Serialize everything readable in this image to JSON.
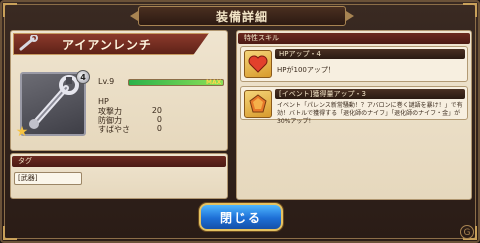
{
  "window": {
    "title": "装備詳細"
  },
  "item": {
    "name": "アイアンレンチ",
    "rarity_badge": "4",
    "level_label": "Lv.9",
    "level_progress": 1.0,
    "level_max_label": "MAX",
    "stats": [
      {
        "label": "HP",
        "value": ""
      },
      {
        "label": "攻撃力",
        "value": "20"
      },
      {
        "label": "防御力",
        "value": "0"
      },
      {
        "label": "すばやさ",
        "value": "0"
      }
    ]
  },
  "tag_section": {
    "header": "タグ",
    "tags": [
      "[武器]"
    ]
  },
  "skill_section": {
    "header": "特性スキル",
    "skills": [
      {
        "name": "HPアップ・4",
        "description": "HPが100アップ！",
        "icon": "heart-icon"
      },
      {
        "name": "[イベント]獲得量アップ・3",
        "description": "イベント「パレンス新常騒動！？アバロンに巻く謎語を暴け！」で有効！バトルで獲得する「退化師のナイフ」「退化師のナイフ・金」が30%アップ！",
        "icon": "gem-icon"
      }
    ]
  },
  "buttons": {
    "close_label": "閉じる"
  },
  "colors": {
    "accent_blue": "#1d6fd6",
    "banner_red": "#8c3a2c",
    "panel_beige": "#efe4cf"
  }
}
